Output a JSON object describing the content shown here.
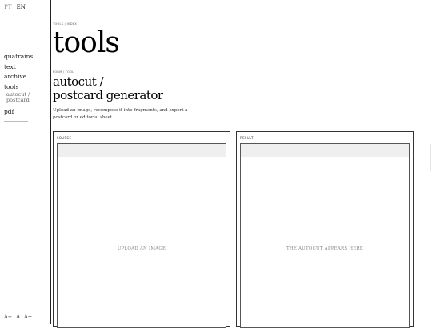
{
  "lang": {
    "pt": "PT",
    "en": "EN",
    "active": "EN"
  },
  "nav": {
    "items": [
      "quatrains",
      "text",
      "archive",
      "tools"
    ],
    "sub": [
      "autocut /",
      "postcard"
    ],
    "pdf": "pdf"
  },
  "fontsize": {
    "decrease": "A−",
    "reset": "A",
    "increase": "A+"
  },
  "header": {
    "crumb": "tools / index",
    "title": "tools"
  },
  "tool": {
    "crumb": "form / tool",
    "title_line1": "autocut /",
    "title_line2": "postcard generator",
    "description": "Upload an image, recompose it into fragments, and export a postcard or editorial sheet."
  },
  "panels": {
    "source_label": "source",
    "source_placeholder": "UPLOAD AN IMAGE",
    "result_label": "result",
    "result_placeholder": "THE AUTOCUT APPEARS HERE"
  }
}
